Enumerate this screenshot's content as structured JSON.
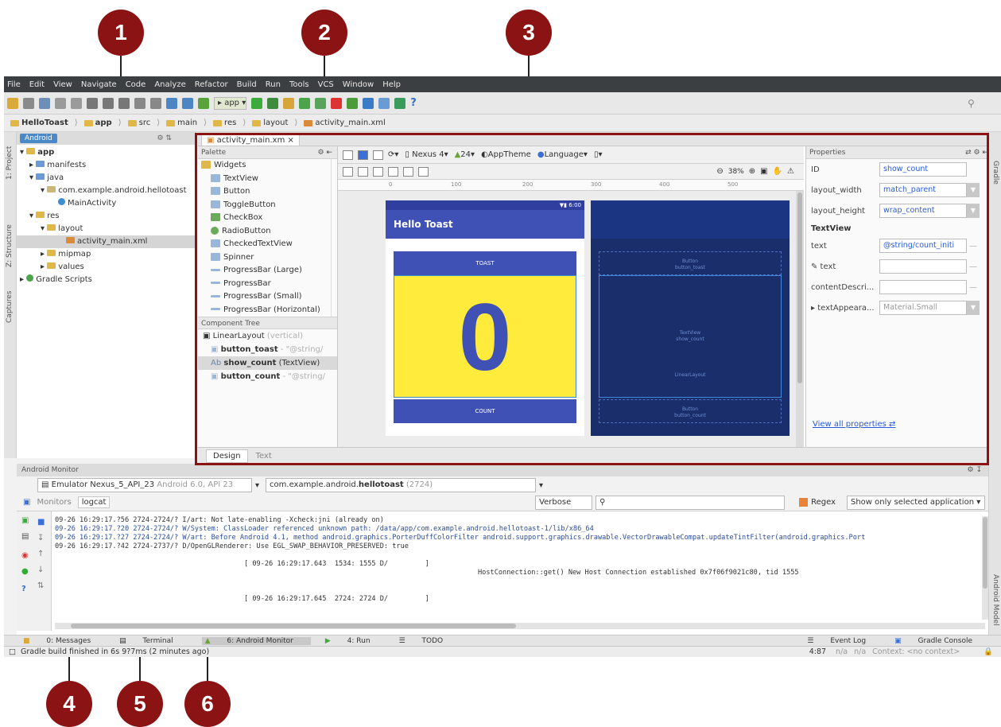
{
  "callouts": [
    "1",
    "2",
    "3",
    "4",
    "5",
    "6"
  ],
  "menu": [
    "File",
    "Edit",
    "View",
    "Navigate",
    "Code",
    "Analyze",
    "Refactor",
    "Build",
    "Run",
    "Tools",
    "VCS",
    "Window",
    "Help"
  ],
  "toolbar": {
    "run_config": "app"
  },
  "breadcrumbs": [
    "HelloToast",
    "app",
    "src",
    "main",
    "res",
    "layout",
    "activity_main.xml"
  ],
  "left_tool_windows": [
    "1: Project",
    "Z: Structure",
    "Captures"
  ],
  "right_tool_windows": [
    "Gradle",
    "Android Model"
  ],
  "project_panel": {
    "tab": "Android",
    "tree": [
      "app",
      "manifests",
      "java",
      "com.example.android.hellotoast",
      "MainActivity",
      "res",
      "layout",
      "activity_main.xml",
      "mipmap",
      "values",
      "Gradle Scripts"
    ]
  },
  "editor": {
    "tab": "activity_main.xm",
    "palette_title": "Palette",
    "palette_group": "Widgets",
    "palette_items": [
      "TextView",
      "Button",
      "ToggleButton",
      "CheckBox",
      "RadioButton",
      "CheckedTextView",
      "Spinner",
      "ProgressBar (Large)",
      "ProgressBar",
      "ProgressBar (Small)",
      "ProgressBar (Horizontal)"
    ],
    "component_tree_title": "Component Tree",
    "component_tree": [
      {
        "name": "LinearLayout",
        "detail": "(vertical)"
      },
      {
        "name": "button_toast",
        "detail": "- \"@string/"
      },
      {
        "name": "show_count",
        "detail": "(TextView)"
      },
      {
        "name": "button_count",
        "detail": "- \"@string/"
      }
    ],
    "canvas_toolbar": {
      "device": "Nexus 4",
      "api": "24",
      "theme": "AppTheme",
      "language": "Language",
      "zoom": "38%"
    },
    "ruler_ticks": [
      "0",
      "100",
      "200",
      "300",
      "400",
      "500"
    ],
    "preview": {
      "time": "6:00",
      "app_title": "Hello Toast",
      "toast_button": "TOAST",
      "count_value": "0",
      "count_button": "COUNT"
    },
    "blueprint": {
      "button_top": [
        "Button",
        "button_toast"
      ],
      "textview": [
        "TextView",
        "show_count"
      ],
      "linear_layout": "LinearLayout",
      "button_bottom": [
        "Button",
        "button_count"
      ]
    },
    "design_tabs": [
      "Design",
      "Text"
    ]
  },
  "properties": {
    "title": "Properties",
    "rows": [
      {
        "label": "ID",
        "value": "show_count"
      },
      {
        "label": "layout_width",
        "value": "match_parent"
      },
      {
        "label": "layout_height",
        "value": "wrap_content"
      }
    ],
    "section": "TextView",
    "text_rows": [
      {
        "label": "text",
        "value": "@string/count_initi"
      },
      {
        "label": "✎ text",
        "value": ""
      },
      {
        "label": "contentDescri...",
        "value": ""
      },
      {
        "label": "▸ textAppeara...",
        "value": "Material.Small"
      }
    ],
    "view_all": "View all properties"
  },
  "android_monitor": {
    "title": "Android Monitor",
    "device": "Emulator Nexus_5_API_23",
    "device_detail": "Android 6.0, API 23",
    "process": "com.example.android.",
    "process_bold": "hellotoast",
    "process_pid": "(2724)",
    "tabs": [
      "Monitors",
      "logcat"
    ],
    "level": "Verbose",
    "regex_label": "Regex",
    "filter": "Show only selected application",
    "log_lines": [
      "09-26 16:29:17.?56 2724-2724/? I/art: Not late-enabling -Xcheck:jni (already on)",
      "09-26 16:29:17.?20 2724-2724/? W/System: ClassLoader referenced unknown path: /data/app/com.example.android.hellotoast-1/lib/x86_64",
      "09-26 16:29:17.?27 2724-2724/? W/art: Before Android 4.1, method android.graphics.PorterDuffColorFilter android.support.graphics.drawable.VectorDrawableCompat.updateTintFilter(android.graphics.Port",
      "09-26 16:29:17.?42 2724-2737/? D/OpenGLRenderer: Use EGL_SWAP_BEHAVIOR_PRESERVED: true",
      "",
      "                                              [ 09-26 16:29:17.643  1534: 1555 D/         ]",
      "                                              HostConnection::get() New Host Connection established 0x7f06f9021c80, tid 1555",
      "",
      "",
      "                                              [ 09-26 16:29:17.645  2724: 2724 D/         ]"
    ]
  },
  "bottom_tabs": [
    "0: Messages",
    "Terminal",
    "6: Android Monitor",
    "4: Run",
    "TODO",
    "Event Log",
    "Gradle Console"
  ],
  "status": {
    "message": "Gradle build finished in 6s 9?7ms (2 minutes ago)",
    "position": "4:87",
    "na1": "n/a",
    "na2": "n/a",
    "context": "Context: <no context>"
  },
  "colors": {
    "callout": "#8b1313",
    "app_bar": "#3f51b5",
    "yellow_text": "#ffeb3b",
    "blueprint": "#1a2e6b",
    "menubar": "#3c3f41"
  }
}
